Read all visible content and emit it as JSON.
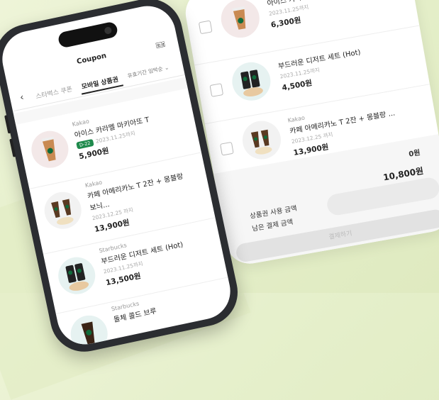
{
  "phone": {
    "title": "Coupon",
    "back_icon": "chevron-left",
    "tabs": [
      {
        "label": "스타벅스 쿠폰",
        "active": false
      },
      {
        "label": "모바일 상품권",
        "active": true
      }
    ],
    "sort_label": "유효기간 임박순",
    "items": [
      {
        "brand": "Kakao",
        "name": "아이스 카라멜 마키아또 T",
        "badge": "D-22",
        "date": "2023.11.25까지",
        "price": "5,900원"
      },
      {
        "brand": "Kakao",
        "name": "카페 아메리카노 T 2잔 + 몽블랑",
        "name2": "보늬...",
        "date": "2023.12.25 까지",
        "price": "13,900원"
      },
      {
        "brand": "Starbucks",
        "name": "부드러운 디저트 세트 (Hot)",
        "date": "2023.11.25까지",
        "price": "13,500원"
      },
      {
        "brand": "Starbucks",
        "name": "돌체 콜드 브루",
        "date": "",
        "price": ""
      }
    ]
  },
  "card": {
    "items": [
      {
        "brand": "",
        "name": "아이스 카라멜",
        "date": "2023.11.25까지",
        "price": "6,300원"
      },
      {
        "brand": "",
        "name": "부드러운 디저트 세트 (Hot)",
        "date": "2023.11.25까지",
        "price": "4,500원"
      },
      {
        "brand": "Kakao",
        "name": "카페 아메리카노 T 2잔 + 몽블랑 ...",
        "date": "2023.12.25 까지",
        "price": "13,900원"
      }
    ],
    "summary": {
      "used_value": "0원",
      "remaining_value": "10,800원",
      "used_label": "상품권 사용 금액",
      "remaining_label": "남은 결제 금액"
    },
    "pay_button": "결제하기"
  }
}
